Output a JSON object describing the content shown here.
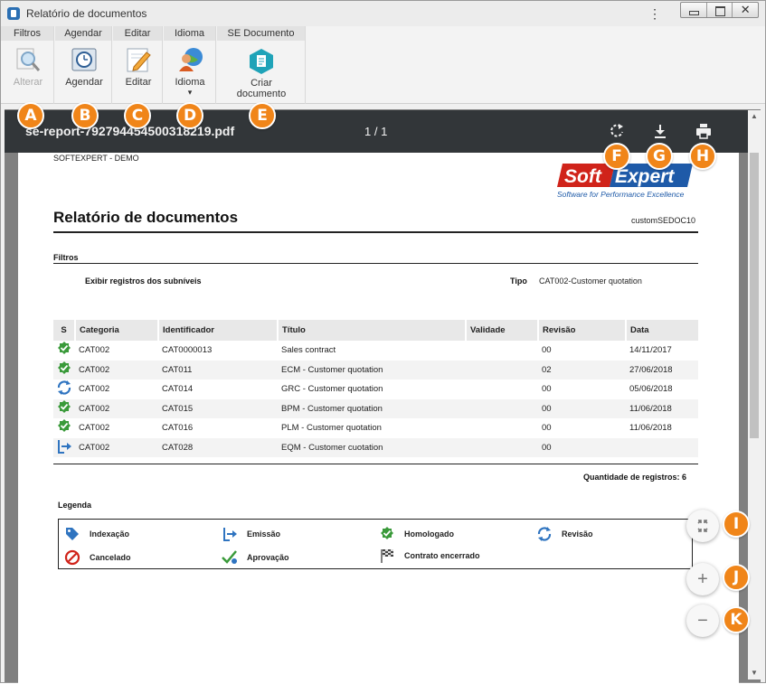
{
  "window": {
    "title": "Relatório de documentos",
    "close_glyph": "✕"
  },
  "ribbon": {
    "groups": [
      {
        "title": "Filtros",
        "button": "Alterar",
        "icon": "magnifier-icon",
        "enabled": false
      },
      {
        "title": "Agendar",
        "button": "Agendar",
        "icon": "clock-icon",
        "enabled": true
      },
      {
        "title": "Editar",
        "button": "Editar",
        "icon": "pencil-icon",
        "enabled": true
      },
      {
        "title": "Idioma",
        "button": "Idioma",
        "icon": "globe-user-icon",
        "enabled": true,
        "dropdown": "▾"
      },
      {
        "title": "SE Documento",
        "button_line1": "Criar",
        "button_line2": "documento",
        "icon": "create-document-icon",
        "enabled": true
      }
    ]
  },
  "viewer": {
    "filename": "se-report-792794454500318219.pdf",
    "page_indicator": "1 / 1",
    "toolbar_icons": [
      "rotate-icon",
      "download-icon",
      "print-icon"
    ]
  },
  "document": {
    "org": "SOFTEXPERT - DEMO",
    "logo": {
      "line1a": "Soft",
      "line1b": "Expert",
      "tagline": "Software for Performance Excellence",
      "brand_red": "#d0231a",
      "brand_blue": "#1e5aa8"
    },
    "title": "Relatório de documentos",
    "code": "customSEDOC10",
    "filters_label": "Filtros",
    "filter_subnivel": "Exibir registros dos subníveis",
    "filter_tipo_label": "Tipo",
    "filter_tipo_value": "CAT002-Customer quotation",
    "table": {
      "headers": [
        "S",
        "Categoria",
        "Identificador",
        "Título",
        "Validade",
        "Revisão",
        "Data"
      ],
      "rows": [
        {
          "status": "homologado-icon",
          "categoria": "CAT002",
          "identificador": "CAT0000013",
          "titulo": "Sales contract",
          "validade": "",
          "revisao": "00",
          "data": "14/11/2017"
        },
        {
          "status": "homologado-icon",
          "categoria": "CAT002",
          "identificador": "CAT011",
          "titulo": "ECM - Customer quotation",
          "validade": "",
          "revisao": "02",
          "data": "27/06/2018"
        },
        {
          "status": "revisao-icon",
          "categoria": "CAT002",
          "identificador": "CAT014",
          "titulo": "GRC - Customer quotation",
          "validade": "",
          "revisao": "00",
          "data": "05/06/2018"
        },
        {
          "status": "homologado-icon",
          "categoria": "CAT002",
          "identificador": "CAT015",
          "titulo": "BPM - Customer quotation",
          "validade": "",
          "revisao": "00",
          "data": "11/06/2018"
        },
        {
          "status": "homologado-icon",
          "categoria": "CAT002",
          "identificador": "CAT016",
          "titulo": "PLM - Customer quotation",
          "validade": "",
          "revisao": "00",
          "data": "11/06/2018"
        },
        {
          "status": "emissao-icon",
          "categoria": "CAT002",
          "identificador": "CAT028",
          "titulo": "EQM - Customer cuotation",
          "validade": "",
          "revisao": "00",
          "data": ""
        }
      ]
    },
    "count_text": "Quantidade de registros: 6",
    "legend": {
      "title": "Legenda",
      "items": [
        {
          "label": "Indexação",
          "icon": "tag-icon"
        },
        {
          "label": "Emissão",
          "icon": "emissao-icon"
        },
        {
          "label": "Homologado",
          "icon": "homologado-icon"
        },
        {
          "label": "Revisão",
          "icon": "revisao-icon"
        },
        {
          "label": "Cancelado",
          "icon": "cancel-icon"
        },
        {
          "label": "Aprovação",
          "icon": "approval-icon"
        },
        {
          "label": "Contrato encerrado",
          "icon": "checkered-flag-icon"
        }
      ]
    }
  },
  "fabs": {
    "fit": "⤡",
    "zoom_in": "+",
    "zoom_out": "−"
  },
  "callouts": [
    "A",
    "B",
    "C",
    "D",
    "E",
    "F",
    "G",
    "H",
    "I",
    "J",
    "K"
  ],
  "colors": {
    "accent_orange": "#f08519",
    "toolbar_dark": "#323639",
    "status_green": "#3a9a3a",
    "status_blue": "#2f74c0"
  }
}
